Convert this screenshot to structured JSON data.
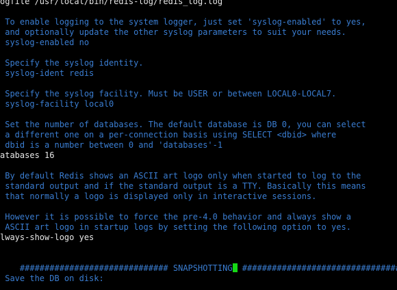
{
  "terminal": {
    "lines": [
      {
        "text": "ogfile /usr/local/bin/redis-log/redis_log.log",
        "kind": "setting"
      },
      {
        "text": "",
        "kind": "blank"
      },
      {
        "text": " To enable logging to the system logger, just set 'syslog-enabled' to yes,",
        "kind": "comment"
      },
      {
        "text": " and optionally update the other syslog parameters to suit your needs.",
        "kind": "comment"
      },
      {
        "text": " syslog-enabled no",
        "kind": "comment"
      },
      {
        "text": "",
        "kind": "blank"
      },
      {
        "text": " Specify the syslog identity.",
        "kind": "comment"
      },
      {
        "text": " syslog-ident redis",
        "kind": "comment"
      },
      {
        "text": "",
        "kind": "blank"
      },
      {
        "text": " Specify the syslog facility. Must be USER or between LOCAL0-LOCAL7.",
        "kind": "comment"
      },
      {
        "text": " syslog-facility local0",
        "kind": "comment"
      },
      {
        "text": "",
        "kind": "blank"
      },
      {
        "text": " Set the number of databases. The default database is DB 0, you can select",
        "kind": "comment"
      },
      {
        "text": " a different one on a per-connection basis using SELECT <dbid> where",
        "kind": "comment"
      },
      {
        "text": " dbid is a number between 0 and 'databases'-1",
        "kind": "comment"
      },
      {
        "text": "atabases 16",
        "kind": "setting"
      },
      {
        "text": "",
        "kind": "blank"
      },
      {
        "text": " By default Redis shows an ASCII art logo only when started to log to the",
        "kind": "comment"
      },
      {
        "text": " standard output and if the standard output is a TTY. Basically this means",
        "kind": "comment"
      },
      {
        "text": " that normally a logo is displayed only in interactive sessions.",
        "kind": "comment"
      },
      {
        "text": "",
        "kind": "blank"
      },
      {
        "text": " However it is possible to force the pre-4.0 behavior and always show a",
        "kind": "comment"
      },
      {
        "text": " ASCII art logo in startup logs by setting the following option to yes.",
        "kind": "comment"
      },
      {
        "text": "lways-show-logo yes",
        "kind": "setting"
      },
      {
        "text": "",
        "kind": "blank"
      },
      {
        "text": "############################## SNAPSHOTTING",
        "kind": "comment",
        "cursor": true,
        "after_cursor": " ################################"
      },
      {
        "text": "",
        "kind": "blank"
      },
      {
        "text": " Save the DB on disk:",
        "kind": "comment"
      }
    ]
  },
  "colors": {
    "background": "#000000",
    "comment": "#3a7dd1",
    "setting": "#e8e8e8",
    "cursor": "#16d816"
  }
}
